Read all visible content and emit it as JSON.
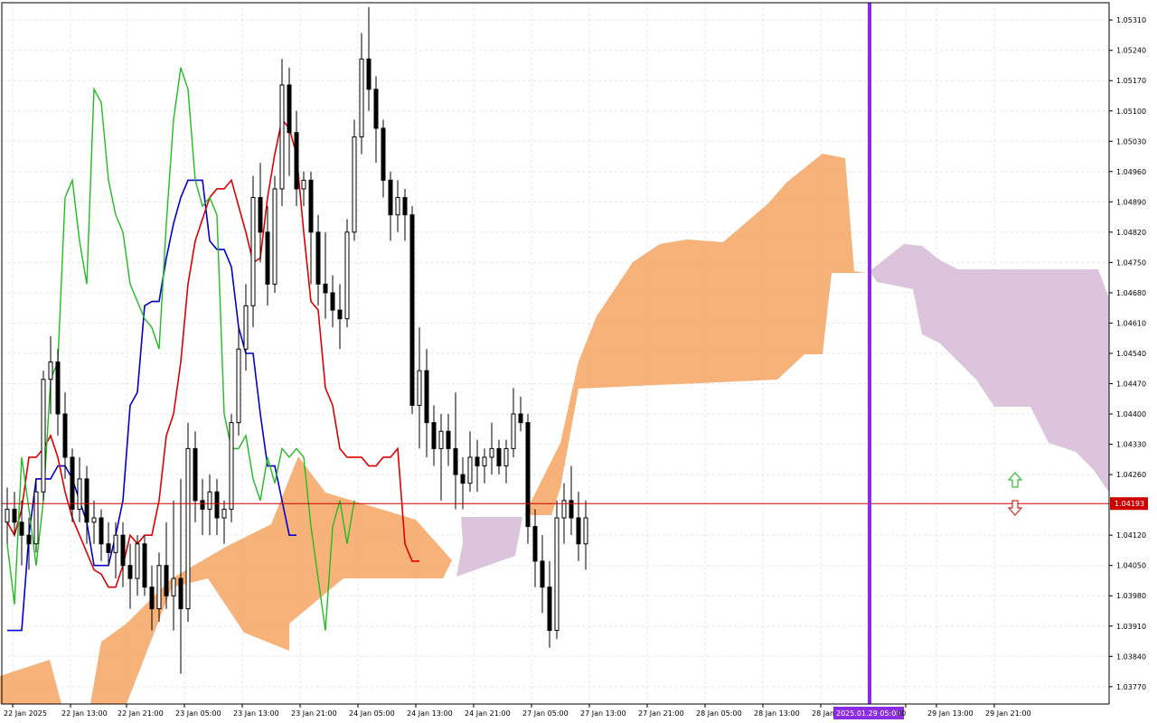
{
  "chart_data": {
    "type": "candlestick",
    "title": "",
    "xlabel": "",
    "ylabel": "",
    "grid": true,
    "ylim": [
      1.0373,
      1.0535
    ],
    "y_ticks": [
      "1.05310",
      "1.05240",
      "1.05170",
      "1.05100",
      "1.05030",
      "1.04960",
      "1.04890",
      "1.04820",
      "1.04750",
      "1.04680",
      "1.04610",
      "1.04540",
      "1.04470",
      "1.04400",
      "1.04330",
      "1.04260",
      "1.04120",
      "1.04050",
      "1.03980",
      "1.03910",
      "1.03840",
      "1.03770"
    ],
    "x_ticks": [
      "22 Jan 2025",
      "22 Jan 13:00",
      "22 Jan 21:00",
      "23 Jan 05:00",
      "23 Jan 13:00",
      "23 Jan 21:00",
      "24 Jan 05:00",
      "24 Jan 13:00",
      "24 Jan 21:00",
      "27 Jan 05:00",
      "27 Jan 13:00",
      "27 Jan 21:00",
      "28 Jan 05:00",
      "28 Jan 13:00",
      "28 Jan",
      "00",
      "29 Jan 13:00",
      "29 Jan 21:00"
    ],
    "current_price": "1.04193",
    "vertical_marker_label": "2025.01.29 05:00",
    "colors": {
      "tenkan": "#dd0000",
      "kijun": "#0000cc",
      "chikou": "#22bb22",
      "cloud_bull": "#f4a460",
      "cloud_bear": "#d8bfd8",
      "marker": "#8b2be2",
      "price_line": "#cc0000",
      "arrow_up": "#33bb33",
      "arrow_down": "#dd2222"
    },
    "candles": [
      {
        "o": 1.0415,
        "h": 1.0423,
        "l": 1.041,
        "c": 1.0418
      },
      {
        "o": 1.0418,
        "h": 1.0422,
        "l": 1.0412,
        "c": 1.0415
      },
      {
        "o": 1.0415,
        "h": 1.042,
        "l": 1.0405,
        "c": 1.0412
      },
      {
        "o": 1.0412,
        "h": 1.0416,
        "l": 1.0404,
        "c": 1.041
      },
      {
        "o": 1.041,
        "h": 1.0425,
        "l": 1.0408,
        "c": 1.0422
      },
      {
        "o": 1.0422,
        "h": 1.045,
        "l": 1.042,
        "c": 1.0448
      },
      {
        "o": 1.0448,
        "h": 1.0458,
        "l": 1.044,
        "c": 1.0452
      },
      {
        "o": 1.0452,
        "h": 1.0455,
        "l": 1.0435,
        "c": 1.044
      },
      {
        "o": 1.044,
        "h": 1.0445,
        "l": 1.0425,
        "c": 1.043
      },
      {
        "o": 1.043,
        "h": 1.0432,
        "l": 1.0415,
        "c": 1.0418
      },
      {
        "o": 1.0418,
        "h": 1.043,
        "l": 1.0415,
        "c": 1.0425
      },
      {
        "o": 1.0425,
        "h": 1.0428,
        "l": 1.041,
        "c": 1.0415
      },
      {
        "o": 1.0415,
        "h": 1.042,
        "l": 1.041,
        "c": 1.0416
      },
      {
        "o": 1.0416,
        "h": 1.0418,
        "l": 1.0406,
        "c": 1.041
      },
      {
        "o": 1.041,
        "h": 1.0415,
        "l": 1.0405,
        "c": 1.0408
      },
      {
        "o": 1.0408,
        "h": 1.0415,
        "l": 1.0402,
        "c": 1.0412
      },
      {
        "o": 1.0412,
        "h": 1.0415,
        "l": 1.04,
        "c": 1.0405
      },
      {
        "o": 1.0405,
        "h": 1.041,
        "l": 1.0395,
        "c": 1.0402
      },
      {
        "o": 1.0402,
        "h": 1.0412,
        "l": 1.0398,
        "c": 1.041
      },
      {
        "o": 1.041,
        "h": 1.0412,
        "l": 1.0398,
        "c": 1.04
      },
      {
        "o": 1.04,
        "h": 1.0405,
        "l": 1.039,
        "c": 1.0395
      },
      {
        "o": 1.0395,
        "h": 1.0408,
        "l": 1.0392,
        "c": 1.0405
      },
      {
        "o": 1.0405,
        "h": 1.0415,
        "l": 1.0395,
        "c": 1.0398
      },
      {
        "o": 1.0398,
        "h": 1.042,
        "l": 1.039,
        "c": 1.0402
      },
      {
        "o": 1.0402,
        "h": 1.0425,
        "l": 1.038,
        "c": 1.0395
      },
      {
        "o": 1.0395,
        "h": 1.0438,
        "l": 1.0392,
        "c": 1.0432
      },
      {
        "o": 1.0432,
        "h": 1.0436,
        "l": 1.0415,
        "c": 1.042
      },
      {
        "o": 1.042,
        "h": 1.0425,
        "l": 1.0412,
        "c": 1.0418
      },
      {
        "o": 1.0418,
        "h": 1.0426,
        "l": 1.0412,
        "c": 1.0422
      },
      {
        "o": 1.0422,
        "h": 1.0425,
        "l": 1.0412,
        "c": 1.0416
      },
      {
        "o": 1.0416,
        "h": 1.042,
        "l": 1.041,
        "c": 1.0418
      },
      {
        "o": 1.0418,
        "h": 1.044,
        "l": 1.0415,
        "c": 1.0438
      },
      {
        "o": 1.0438,
        "h": 1.046,
        "l": 1.0435,
        "c": 1.0455
      },
      {
        "o": 1.0455,
        "h": 1.047,
        "l": 1.045,
        "c": 1.0465
      },
      {
        "o": 1.0465,
        "h": 1.0495,
        "l": 1.046,
        "c": 1.049
      },
      {
        "o": 1.049,
        "h": 1.0498,
        "l": 1.0475,
        "c": 1.0482
      },
      {
        "o": 1.0482,
        "h": 1.0488,
        "l": 1.0465,
        "c": 1.047
      },
      {
        "o": 1.047,
        "h": 1.0495,
        "l": 1.0468,
        "c": 1.0492
      },
      {
        "o": 1.0492,
        "h": 1.0522,
        "l": 1.0488,
        "c": 1.0516
      },
      {
        "o": 1.0516,
        "h": 1.052,
        "l": 1.0495,
        "c": 1.0505
      },
      {
        "o": 1.0505,
        "h": 1.051,
        "l": 1.0488,
        "c": 1.0492
      },
      {
        "o": 1.0492,
        "h": 1.0496,
        "l": 1.0488,
        "c": 1.0494
      },
      {
        "o": 1.0494,
        "h": 1.0496,
        "l": 1.047,
        "c": 1.0482
      },
      {
        "o": 1.0482,
        "h": 1.0486,
        "l": 1.0465,
        "c": 1.047
      },
      {
        "o": 1.047,
        "h": 1.0482,
        "l": 1.0462,
        "c": 1.0468
      },
      {
        "o": 1.0468,
        "h": 1.0472,
        "l": 1.046,
        "c": 1.0464
      },
      {
        "o": 1.0464,
        "h": 1.047,
        "l": 1.0455,
        "c": 1.0462
      },
      {
        "o": 1.0462,
        "h": 1.0485,
        "l": 1.046,
        "c": 1.0482
      },
      {
        "o": 1.0482,
        "h": 1.0508,
        "l": 1.048,
        "c": 1.0504
      },
      {
        "o": 1.0504,
        "h": 1.0528,
        "l": 1.05,
        "c": 1.0522
      },
      {
        "o": 1.0522,
        "h": 1.0534,
        "l": 1.051,
        "c": 1.0515
      },
      {
        "o": 1.0515,
        "h": 1.0518,
        "l": 1.0498,
        "c": 1.0506
      },
      {
        "o": 1.0506,
        "h": 1.0508,
        "l": 1.049,
        "c": 1.0494
      },
      {
        "o": 1.0494,
        "h": 1.0496,
        "l": 1.048,
        "c": 1.0486
      },
      {
        "o": 1.0486,
        "h": 1.0494,
        "l": 1.0482,
        "c": 1.049
      },
      {
        "o": 1.049,
        "h": 1.0492,
        "l": 1.048,
        "c": 1.0486
      },
      {
        "o": 1.0486,
        "h": 1.0488,
        "l": 1.044,
        "c": 1.0442
      },
      {
        "o": 1.0442,
        "h": 1.046,
        "l": 1.0432,
        "c": 1.045
      },
      {
        "o": 1.045,
        "h": 1.0455,
        "l": 1.043,
        "c": 1.0438
      },
      {
        "o": 1.0438,
        "h": 1.0442,
        "l": 1.0428,
        "c": 1.0432
      },
      {
        "o": 1.0432,
        "h": 1.044,
        "l": 1.042,
        "c": 1.0436
      },
      {
        "o": 1.0436,
        "h": 1.044,
        "l": 1.0428,
        "c": 1.0432
      },
      {
        "o": 1.0432,
        "h": 1.0445,
        "l": 1.0418,
        "c": 1.0426
      },
      {
        "o": 1.0426,
        "h": 1.043,
        "l": 1.0418,
        "c": 1.0424
      },
      {
        "o": 1.0424,
        "h": 1.0436,
        "l": 1.0422,
        "c": 1.043
      },
      {
        "o": 1.043,
        "h": 1.0434,
        "l": 1.0422,
        "c": 1.0428
      },
      {
        "o": 1.0428,
        "h": 1.0432,
        "l": 1.0424,
        "c": 1.043
      },
      {
        "o": 1.043,
        "h": 1.0438,
        "l": 1.0426,
        "c": 1.0432
      },
      {
        "o": 1.0432,
        "h": 1.0434,
        "l": 1.0426,
        "c": 1.0428
      },
      {
        "o": 1.0428,
        "h": 1.0434,
        "l": 1.0424,
        "c": 1.0432
      },
      {
        "o": 1.0432,
        "h": 1.0446,
        "l": 1.043,
        "c": 1.044
      },
      {
        "o": 1.044,
        "h": 1.0444,
        "l": 1.0436,
        "c": 1.0438
      },
      {
        "o": 1.0438,
        "h": 1.044,
        "l": 1.041,
        "c": 1.0414
      },
      {
        "o": 1.0414,
        "h": 1.0418,
        "l": 1.04,
        "c": 1.0406
      },
      {
        "o": 1.0406,
        "h": 1.0412,
        "l": 1.0394,
        "c": 1.04
      },
      {
        "o": 1.04,
        "h": 1.0406,
        "l": 1.0386,
        "c": 1.039
      },
      {
        "o": 1.039,
        "h": 1.042,
        "l": 1.0388,
        "c": 1.0416
      },
      {
        "o": 1.0416,
        "h": 1.0424,
        "l": 1.041,
        "c": 1.042
      },
      {
        "o": 1.042,
        "h": 1.0428,
        "l": 1.0412,
        "c": 1.0416
      },
      {
        "o": 1.0416,
        "h": 1.0422,
        "l": 1.0406,
        "c": 1.041
      },
      {
        "o": 1.041,
        "h": 1.042,
        "l": 1.0404,
        "c": 1.0416
      }
    ],
    "tenkan": [
      1.0415,
      1.0412,
      1.0418,
      1.043,
      1.043,
      1.0432,
      1.0435,
      1.043,
      1.0422,
      1.0416,
      1.0412,
      1.0408,
      1.0404,
      1.0403,
      1.04,
      1.04,
      1.0405,
      1.0412,
      1.041,
      1.0412,
      1.0412,
      1.042,
      1.0435,
      1.044,
      1.0452,
      1.047,
      1.048,
      1.0485,
      1.049,
      1.0492,
      1.0492,
      1.0494,
      1.0488,
      1.0482,
      1.0475,
      1.0476,
      1.049,
      1.05,
      1.0508,
      1.0506,
      1.05,
      1.0482,
      1.0466,
      1.0464,
      1.0446,
      1.0442,
      1.0432,
      1.043,
      1.043,
      1.043,
      1.0428,
      1.0428,
      1.043,
      1.043,
      1.0432,
      1.041,
      1.0406,
      1.0406
    ],
    "kijun": [
      1.039,
      1.039,
      1.039,
      1.0412,
      1.0425,
      1.0425,
      1.0425,
      1.0428,
      1.0428,
      1.0425,
      1.042,
      1.0415,
      1.0405,
      1.0405,
      1.0405,
      1.0412,
      1.042,
      1.0442,
      1.0445,
      1.0465,
      1.0466,
      1.0466,
      1.0476,
      1.0484,
      1.049,
      1.0494,
      1.0494,
      1.0494,
      1.048,
      1.0478,
      1.0478,
      1.0474,
      1.046,
      1.0454,
      1.0454,
      1.044,
      1.0428,
      1.0428,
      1.042,
      1.0412,
      1.0412
    ],
    "chikou": [
      1.041,
      1.0396,
      1.043,
      1.0418,
      1.0405,
      1.042,
      1.0448,
      1.0452,
      1.049,
      1.0494,
      1.048,
      1.047,
      1.0515,
      1.0512,
      1.0494,
      1.0486,
      1.0482,
      1.047,
      1.0466,
      1.0462,
      1.046,
      1.0455,
      1.0484,
      1.0508,
      1.052,
      1.0515,
      1.0494,
      1.0488,
      1.049,
      1.0486,
      1.044,
      1.0432,
      1.0432,
      1.0435,
      1.0425,
      1.042,
      1.043,
      1.0424,
      1.0432,
      1.043,
      1.0432,
      1.043,
      1.0414,
      1.0402,
      1.039,
      1.0414,
      1.042,
      1.041,
      1.042
    ]
  }
}
